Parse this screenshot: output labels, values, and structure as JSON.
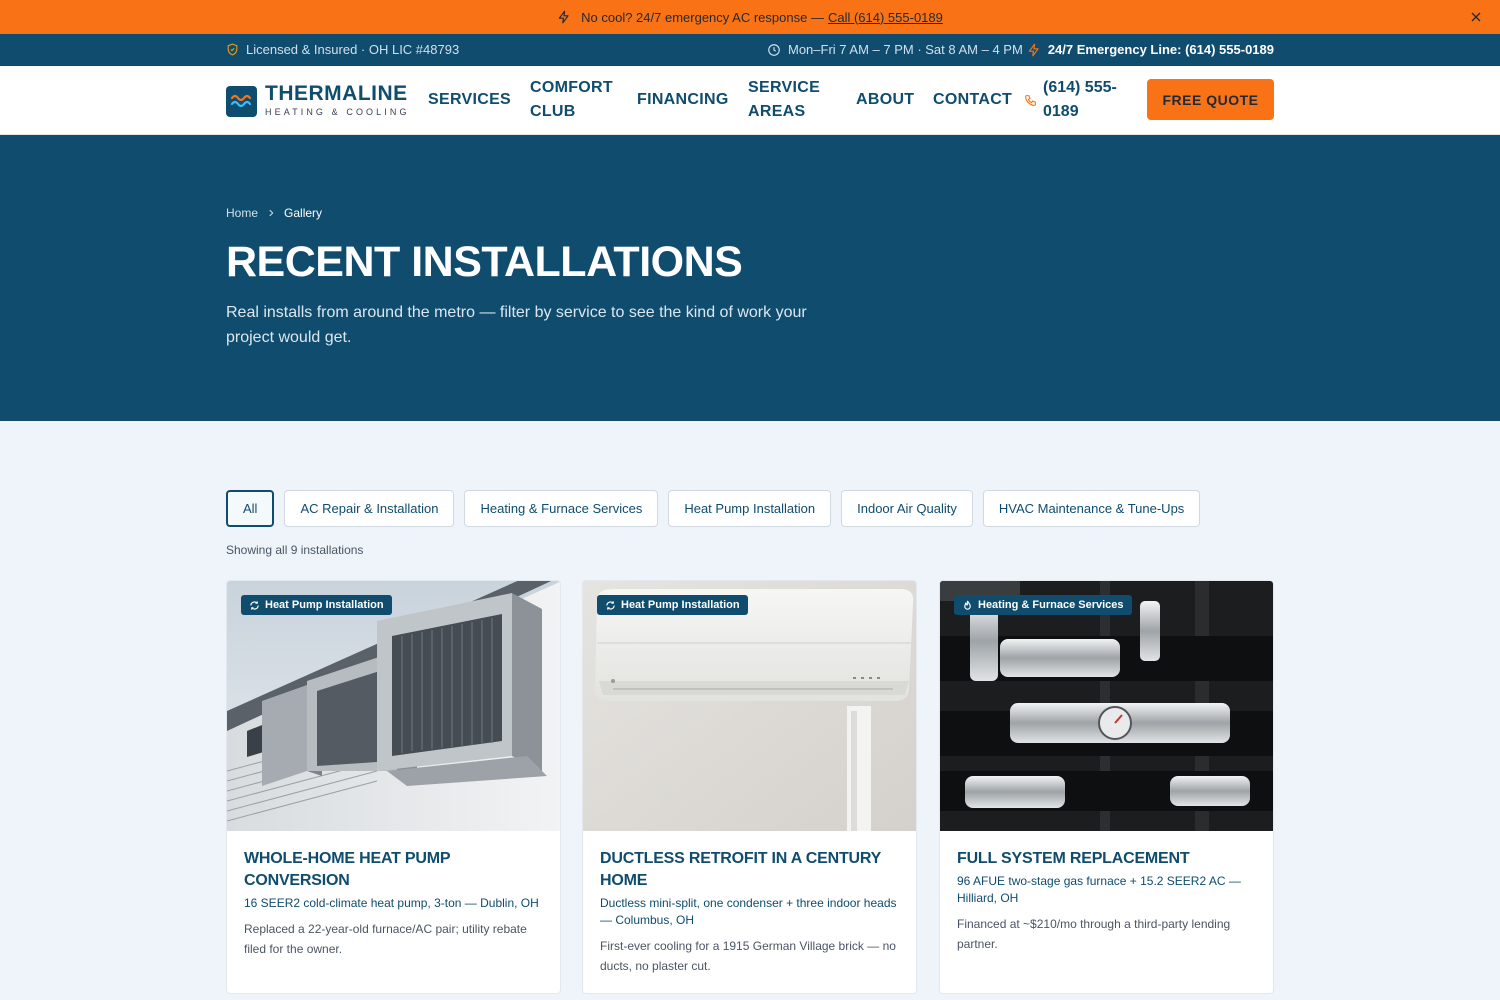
{
  "promo": {
    "text": "No cool? 24/7 emergency AC response —",
    "link": "Call (614) 555-0189"
  },
  "utility": {
    "license": "Licensed & Insured · OH LIC #48793",
    "hours": "Mon–Fri 7 AM – 7 PM · Sat 8 AM – 4 PM",
    "emergency": "24/7 Emergency Line: (614) 555-0189"
  },
  "header": {
    "brand": "THERMALINE",
    "brand_sub": "HEATING & COOLING",
    "nav": [
      "SERVICES",
      "COMFORT CLUB",
      "FINANCING",
      "SERVICE AREAS",
      "ABOUT",
      "CONTACT"
    ],
    "phone": "(614) 555-0189",
    "cta": "FREE QUOTE"
  },
  "hero": {
    "breadcrumb_home": "Home",
    "breadcrumb_current": "Gallery",
    "title": "RECENT INSTALLATIONS",
    "subtitle": "Real installs from around the metro — filter by service to see the kind of work your project would get."
  },
  "filters": {
    "items": [
      "All",
      "AC Repair & Installation",
      "Heating & Furnace Services",
      "Heat Pump Installation",
      "Indoor Air Quality",
      "HVAC Maintenance & Tune-Ups"
    ],
    "active": "All",
    "count_text": "Showing all 9 installations"
  },
  "cards": [
    {
      "badge": "Heat Pump Installation",
      "badge_icon": "refresh-icon",
      "title": "WHOLE-HOME HEAT PUMP CONVERSION",
      "spec": "16 SEER2 cold-climate heat pump, 3-ton — Dublin, OH",
      "desc": "Replaced a 22-year-old furnace/AC pair; utility rebate filed for the owner."
    },
    {
      "badge": "Heat Pump Installation",
      "badge_icon": "refresh-icon",
      "title": "DUCTLESS RETROFIT IN A CENTURY HOME",
      "spec": "Ductless mini-split, one condenser + three indoor heads — Columbus, OH",
      "desc": "First-ever cooling for a 1915 German Village brick — no ducts, no plaster cut."
    },
    {
      "badge": "Heating & Furnace Services",
      "badge_icon": "flame-icon",
      "title": "FULL SYSTEM REPLACEMENT",
      "spec": "96 AFUE two-stage gas furnace + 15.2 SEER2 AC — Hilliard, OH",
      "desc": "Financed at ~$210/mo through a third-party lending partner."
    }
  ],
  "colors": {
    "brand_navy": "#0f4c6e",
    "accent_orange": "#f97316",
    "page_bg": "#eef4f9"
  }
}
